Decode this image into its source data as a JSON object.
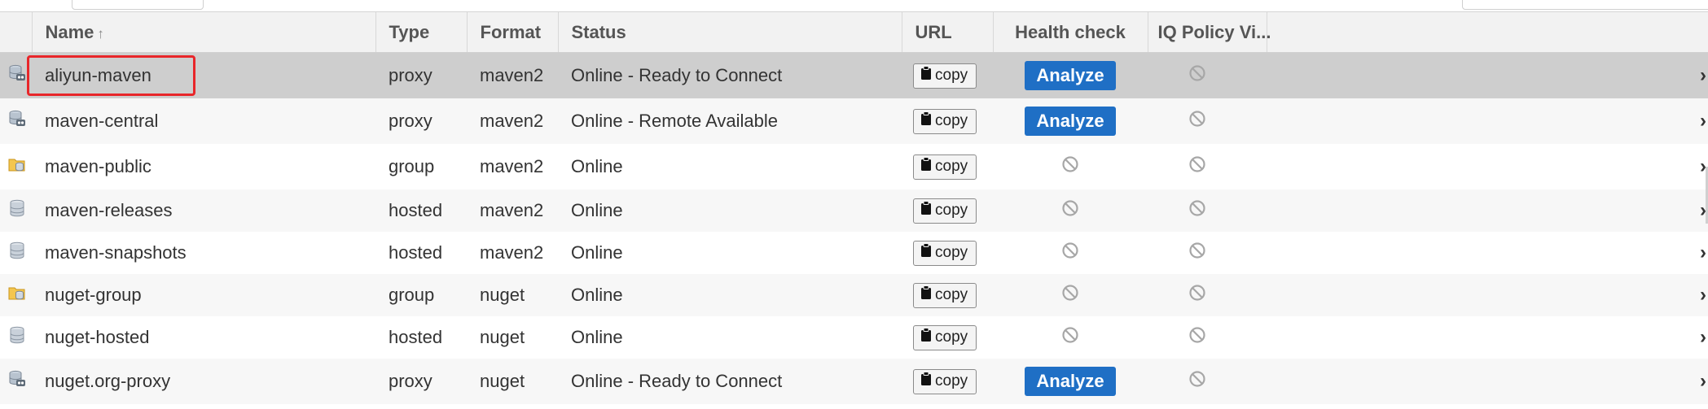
{
  "columns": {
    "name": "Name",
    "type": "Type",
    "format": "Format",
    "status": "Status",
    "url": "URL",
    "health": "Health check",
    "iq": "IQ Policy Vi..."
  },
  "icons": {
    "sort": "sort-ascending-icon",
    "proxy": "proxy-repository-icon",
    "group": "group-repository-icon",
    "hosted": "hosted-repository-icon",
    "clipboard": "clipboard-icon",
    "na": "not-available-icon",
    "chevron": "chevron-right-icon"
  },
  "colors": {
    "accent": "#1f6fc5",
    "highlight": "#e8262a",
    "selected_row": "#cecece"
  },
  "copy_label": "copy",
  "analyze_label": "Analyze",
  "rows": [
    {
      "name": "aliyun-maven",
      "type": "proxy",
      "format": "maven2",
      "status": "Online - Ready to Connect",
      "health": "analyze",
      "selected": true
    },
    {
      "name": "maven-central",
      "type": "proxy",
      "format": "maven2",
      "status": "Online - Remote Available",
      "health": "analyze",
      "selected": false
    },
    {
      "name": "maven-public",
      "type": "group",
      "format": "maven2",
      "status": "Online",
      "health": "na",
      "selected": false
    },
    {
      "name": "maven-releases",
      "type": "hosted",
      "format": "maven2",
      "status": "Online",
      "health": "na",
      "selected": false
    },
    {
      "name": "maven-snapshots",
      "type": "hosted",
      "format": "maven2",
      "status": "Online",
      "health": "na",
      "selected": false
    },
    {
      "name": "nuget-group",
      "type": "group",
      "format": "nuget",
      "status": "Online",
      "health": "na",
      "selected": false
    },
    {
      "name": "nuget-hosted",
      "type": "hosted",
      "format": "nuget",
      "status": "Online",
      "health": "na",
      "selected": false
    },
    {
      "name": "nuget.org-proxy",
      "type": "proxy",
      "format": "nuget",
      "status": "Online - Ready to Connect",
      "health": "analyze",
      "selected": false
    }
  ]
}
